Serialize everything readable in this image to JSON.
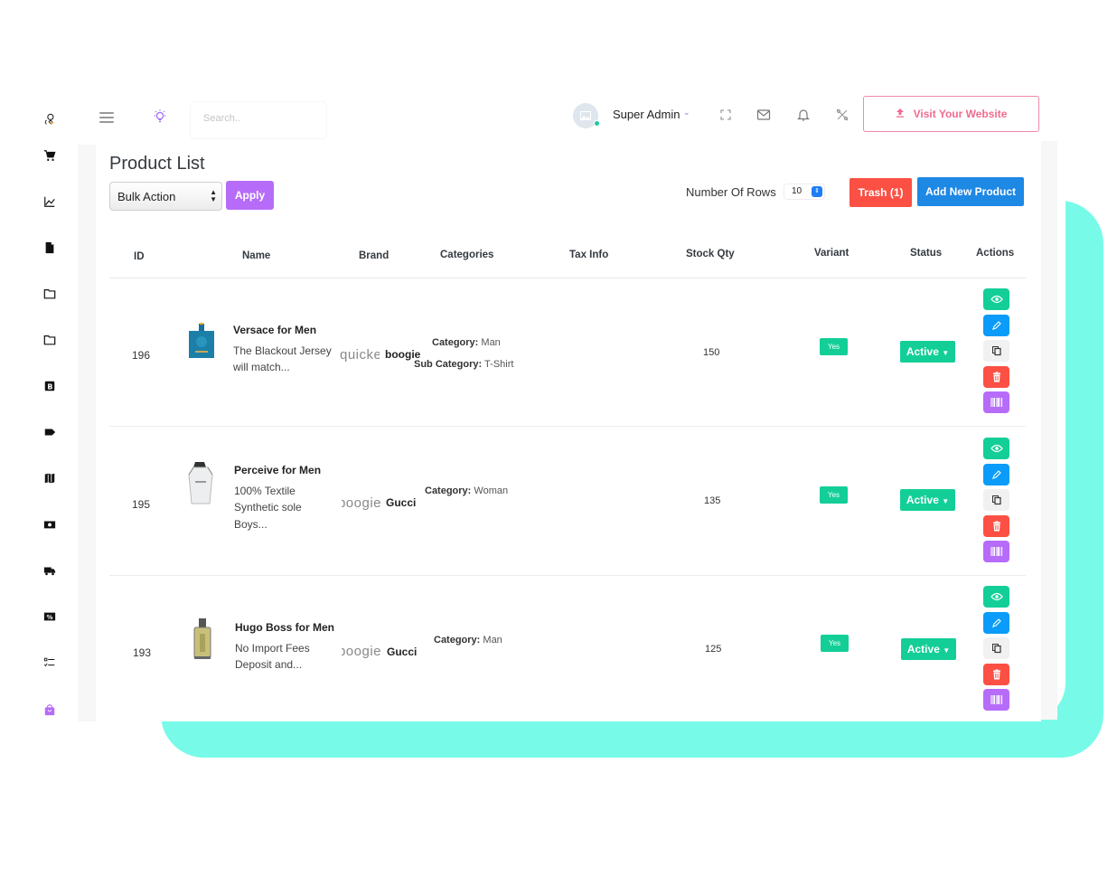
{
  "topbar": {
    "search_placeholder": "Search..",
    "admin_name": "Super Admin",
    "visit_label": "Visit Your Website"
  },
  "sidebar": {
    "items": [
      {
        "icon": "logo-icon"
      },
      {
        "icon": "cart-icon"
      },
      {
        "icon": "chart-icon"
      },
      {
        "icon": "file-icon"
      },
      {
        "icon": "folder-icon"
      },
      {
        "icon": "folder-icon"
      },
      {
        "icon": "blog-icon"
      },
      {
        "icon": "tag-icon"
      },
      {
        "icon": "map-icon"
      },
      {
        "icon": "money-icon"
      },
      {
        "icon": "truck-icon"
      },
      {
        "icon": "coupon-icon"
      },
      {
        "icon": "checklist-icon"
      },
      {
        "icon": "shopping-bag-icon",
        "active": true
      }
    ]
  },
  "page": {
    "title": "Product List",
    "bulk_action": "Bulk Action",
    "apply_label": "Apply",
    "rows_label": "Number Of Rows",
    "rows_value": "10",
    "trash_label": "Trash (1)",
    "add_label": "Add New Product"
  },
  "table": {
    "headers": [
      "ID",
      "Name",
      "Brand",
      "Categories",
      "Tax Info",
      "Stock Qty",
      "Variant",
      "Status",
      "Actions"
    ],
    "rows": [
      {
        "id": "196",
        "name": "Versace for Men",
        "desc1": "The Blackout Jersey",
        "desc2": "will match...",
        "desc3": "",
        "brand_logo": "quicke",
        "brand": "boogie",
        "category_label": "Category:",
        "category": "Man",
        "subcategory_label": "Sub Category:",
        "subcategory": "T-Shirt",
        "stock": "150",
        "variant": "Yes",
        "status": "Active"
      },
      {
        "id": "195",
        "name": "Perceive for Men",
        "desc1": "100% Textile",
        "desc2": "Synthetic sole",
        "desc3": "Boys...",
        "brand_logo": "boogie",
        "brand": "Gucci",
        "category_label": "Category:",
        "category": "Woman",
        "stock": "135",
        "variant": "Yes",
        "status": "Active"
      },
      {
        "id": "193",
        "name": "Hugo Boss for Men",
        "desc1": "No Import Fees",
        "desc2": "Deposit and...",
        "desc3": "",
        "brand_logo": "boogie",
        "brand": "Gucci",
        "category_label": "Category:",
        "category": "Man",
        "stock": "125",
        "variant": "Yes",
        "status": "Active"
      }
    ]
  },
  "colors": {
    "accent_purple": "#b66cf8",
    "success": "#13cf97",
    "danger": "#fc5044",
    "primary": "#1e88e5",
    "teal_bg": "#77fbe8",
    "visit_pink": "#f06b8f"
  }
}
